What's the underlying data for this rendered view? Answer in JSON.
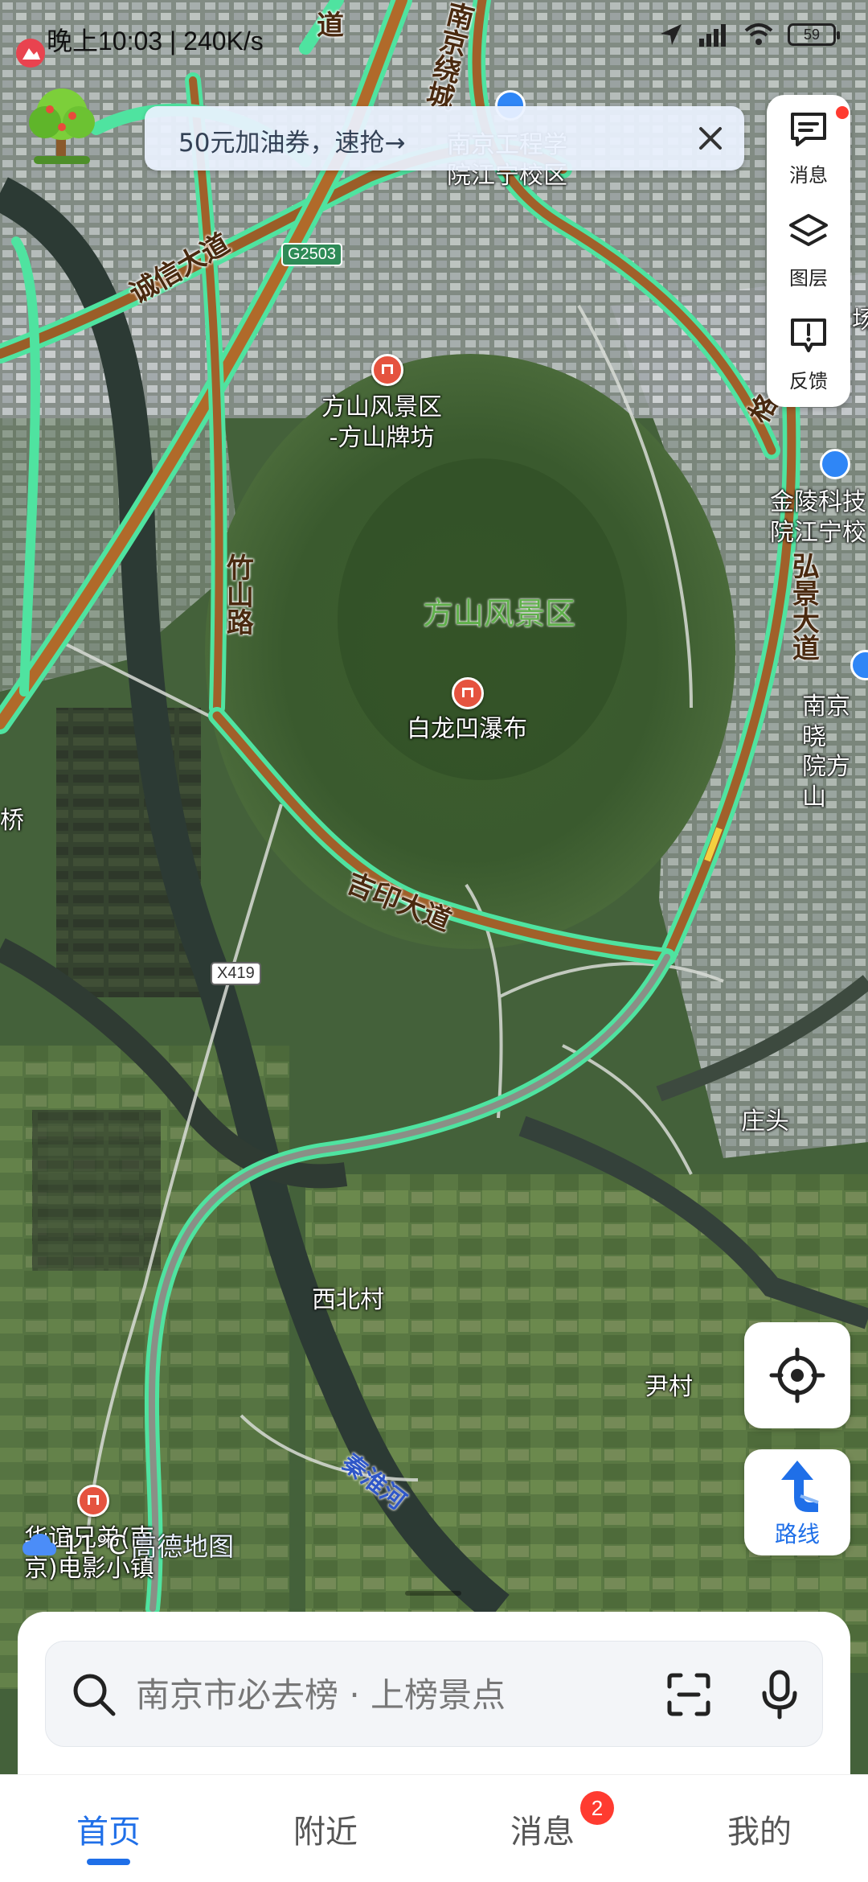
{
  "status_bar": {
    "time_text": "晚上10:03 | 240K/s",
    "battery": "59"
  },
  "banner": {
    "text": "50元加油券，速抢→"
  },
  "tools": {
    "messages_label": "消息",
    "layers_label": "图层",
    "feedback_label": "反馈"
  },
  "map": {
    "labels": {
      "nanjing_eng_campus": "南京工程学\n院江宁校区",
      "jinling_campus": "金陵科技\n院江宁校",
      "nanjing_xiao_campus": "南京晓\n院方山",
      "fangshan_gate": "方山风景区\n-方山牌坊",
      "fangshan_area": "方山风景区",
      "bailong_waterfall": "白龙凹瀑布",
      "zhuangtou": "庄头",
      "xibei_village": "西北村",
      "yin_village": "尹村",
      "movie_town": "华谊兄弟(南\n京)电影小镇",
      "qiao": "桥",
      "chang": "场"
    },
    "roads": {
      "chengxin": "诚信大道",
      "zhushan": "竹山路",
      "jiyin": "吉印大道",
      "hongjing": "弘景大道",
      "nanjing_ring": "南京绕城",
      "dao": "道",
      "ge": "格"
    },
    "shields": {
      "g2503": "G2503",
      "x419": "X419"
    },
    "river": "秦淮河"
  },
  "watermark": {
    "temperature": "11°C",
    "brand": "高德地图"
  },
  "route_button": {
    "label": "路线"
  },
  "search": {
    "placeholder": "南京市必去榜 · 上榜景点"
  },
  "tabs": [
    {
      "label": "首页",
      "active": true
    },
    {
      "label": "附近",
      "active": false
    },
    {
      "label": "消息",
      "active": false,
      "badge": "2"
    },
    {
      "label": "我的",
      "active": false
    }
  ],
  "colors": {
    "accent": "#1f6fe8",
    "road_glow": "#4fe3a0",
    "road_fill": "#b06a2a",
    "badge": "#ff3b30"
  }
}
